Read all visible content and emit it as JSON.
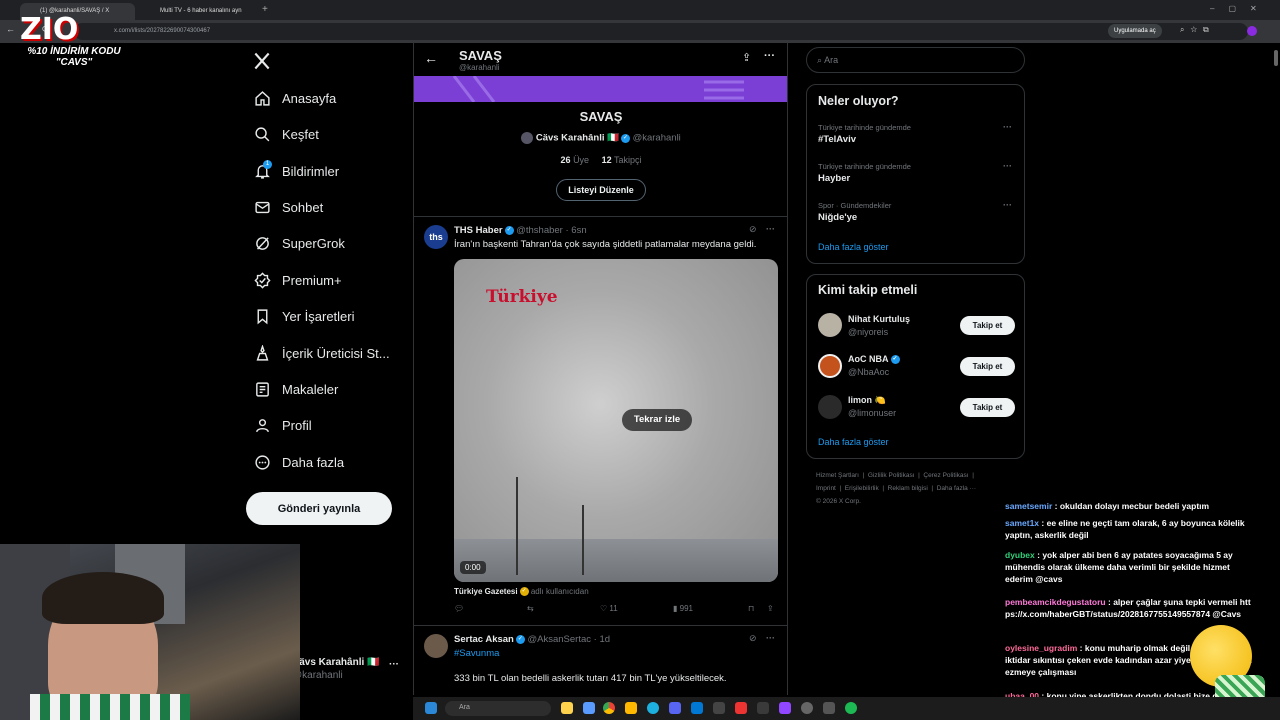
{
  "browser": {
    "tabs": [
      {
        "label": "(1) @karahanli/SAVAŞ / X"
      },
      {
        "label": "Multi TV - 6 haber kanalını ayn"
      }
    ],
    "url": "x.com/i/lists/2027822690074300467",
    "open_app_label": "Uygulamada aç"
  },
  "overlay": {
    "brand": "ZIO",
    "promo_line1": "%10 İNDİRİM KODU",
    "promo_line2": "\"CAVS\""
  },
  "nav": {
    "items": [
      {
        "label": "Anasayfa",
        "icon": "home-icon"
      },
      {
        "label": "Keşfet",
        "icon": "search-icon"
      },
      {
        "label": "Bildirimler",
        "icon": "bell-icon",
        "badge": "1"
      },
      {
        "label": "Sohbet",
        "icon": "mail-icon"
      },
      {
        "label": "SuperGrok",
        "icon": "grok-icon"
      },
      {
        "label": "Premium+",
        "icon": "premium-icon"
      },
      {
        "label": "Yer İşaretleri",
        "icon": "bookmark-icon"
      },
      {
        "label": "İçerik Üreticisi St...",
        "icon": "creator-icon"
      },
      {
        "label": "Makaleler",
        "icon": "article-icon"
      },
      {
        "label": "Profil",
        "icon": "person-icon"
      },
      {
        "label": "Daha fazla",
        "icon": "more-circle-icon"
      }
    ],
    "post_label": "Gönderi yayınla",
    "account_name": "Cävs Karahânli 🇮🇹",
    "account_handle": "@karahanli"
  },
  "list": {
    "header_title": "SAVAŞ",
    "header_handle": "@karahanli",
    "title": "SAVAŞ",
    "owner_name": "Cävs Karahânli 🇮🇹",
    "owner_handle": "@karahanli",
    "members_count": "26",
    "members_label": "Üye",
    "followers_count": "12",
    "followers_label": "Takipçi",
    "edit_label": "Listeyi Düzenle"
  },
  "tweets": [
    {
      "name": "THS Haber",
      "handle": "@thshaber",
      "time": "6sn",
      "text": "İran'ın başkenti Tahran'da çok sayıda şiddetli patlamalar meydana geldi.",
      "media_logo": "Türkiye",
      "replay_label": "Tekrar izle",
      "video_time": "0:00",
      "source_name": "Türkiye Gazetesi",
      "source_note": "adlı kullanıcıdan",
      "likes": "11",
      "views": "991"
    },
    {
      "name": "Sertac Aksan",
      "handle": "@AksanSertac",
      "time": "1d",
      "hashtag": "#Savunma",
      "text": "333 bin TL olan bedelli askerlik tutarı 417 bin TL'ye yükseltilecek."
    }
  ],
  "sidebar": {
    "search_placeholder": "Ara",
    "trends_title": "Neler oluyor?",
    "trends": [
      {
        "context": "Türkiye tarihinde gündemde",
        "name": "#TelAviv"
      },
      {
        "context": "Türkiye tarihinde gündemde",
        "name": "Hayber"
      },
      {
        "context": "Spor · Gündemdekiler",
        "name": "Niğde'ye"
      }
    ],
    "trends_more": "Daha fazla göster",
    "who_title": "Kimi takip etmeli",
    "who": [
      {
        "name": "Nihat Kurtuluş",
        "handle": "@niyoreis",
        "button": "Takip et"
      },
      {
        "name": "AoC NBA",
        "handle": "@NbaAoc",
        "button": "Takip et"
      },
      {
        "name": "limon 🍋",
        "handle": "@limonuser",
        "button": "Takip et"
      }
    ],
    "who_more": "Daha fazla göster",
    "footer_line1": [
      "Hizmet Şartları",
      "Gizlilik Politikası",
      "Çerez Politikası"
    ],
    "footer_line2": [
      "Imprint",
      "Erişilebilirlik",
      "Reklam bilgisi",
      "Daha fazla ···"
    ],
    "copyright": "© 2026 X Corp."
  },
  "chat": [
    {
      "user": "sametsemir",
      "msg": ": okuldan dolayı mecbur bedeli yaptım",
      "color": "#6aa9ff"
    },
    {
      "user": "samet1x",
      "msg": ": ee eline ne geçti tam olarak, 6 ay boyunca kölelik yaptın, askerlik değil",
      "color": "#6aa9ff"
    },
    {
      "user": "dyubex",
      "msg": ": yok alper abi ben 6 ay patates soyacağıma 5 ay mühendis olarak ülkeme daha verimli bir şekilde hizmet ederim @cavs",
      "color": "#33d17a"
    },
    {
      "user": "pembeamcikdegustatoru",
      "msg": ": alper çağlar şuna tepki vermeli https://x.com/haberGBT/status/2028167755149557874 @Cavs",
      "color": "#ff7ad9"
    },
    {
      "user": "oylesine_ugradim",
      "msg": ": konu muharip olmak değil zaten konu iktidar sıkıntısı çeken evde kadından azar yiyen uzmanın seni ezmeye çalışması",
      "color": "#ff6b9a"
    },
    {
      "user": "ubaa_00",
      "msg": ": konu yine askerlikten dondu dolasti bize geldi saliz",
      "color": "#ff6b9a"
    }
  ],
  "taskbar": {
    "search_placeholder": "Ara"
  }
}
